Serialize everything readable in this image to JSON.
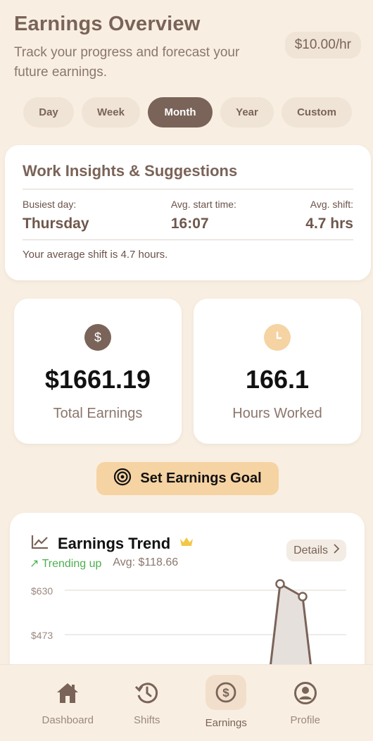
{
  "header": {
    "title": "Earnings Overview",
    "subtitle": "Track your progress and forecast your future earnings.",
    "rate": "$10.00/hr"
  },
  "periods": [
    {
      "label": "Day",
      "active": false
    },
    {
      "label": "Week",
      "active": false
    },
    {
      "label": "Month",
      "active": true
    },
    {
      "label": "Year",
      "active": false
    },
    {
      "label": "Custom",
      "active": false
    }
  ],
  "insights": {
    "title": "Work Insights & Suggestions",
    "busiest_label": "Busiest day:",
    "busiest_value": "Thursday",
    "start_label": "Avg. start time:",
    "start_value": "16:07",
    "shift_label": "Avg. shift:",
    "shift_value": "4.7 hrs",
    "note": "Your average shift is 4.7 hours."
  },
  "stats": {
    "earnings_value": "$1661.19",
    "earnings_label": "Total Earnings",
    "hours_value": "166.1",
    "hours_label": "Hours Worked",
    "earnings_icon": "dollar-icon",
    "hours_icon": "clock-icon"
  },
  "goal_button": {
    "label": "Set Earnings Goal",
    "icon": "target-icon"
  },
  "trend": {
    "title": "Earnings Trend",
    "trending": "Trending up",
    "avg": "Avg: $118.66",
    "details": "Details",
    "y_ticks": [
      "$630",
      "$473"
    ]
  },
  "chart_data": {
    "type": "area",
    "title": "Earnings Trend",
    "y_ticks": [
      630,
      473
    ],
    "visible_points": [
      640,
      592
    ]
  },
  "tabs": [
    {
      "label": "Dashboard",
      "icon": "home-icon",
      "active": false
    },
    {
      "label": "Shifts",
      "icon": "history-icon",
      "active": false
    },
    {
      "label": "Earnings",
      "icon": "dollar-circle-icon",
      "active": true
    },
    {
      "label": "Profile",
      "icon": "user-icon",
      "active": false
    }
  ],
  "colors": {
    "background": "#f8efe2",
    "accent": "#7a6358",
    "goal": "#f6d3a3",
    "trend_up": "#4caf50",
    "crown": "#f2c744"
  }
}
